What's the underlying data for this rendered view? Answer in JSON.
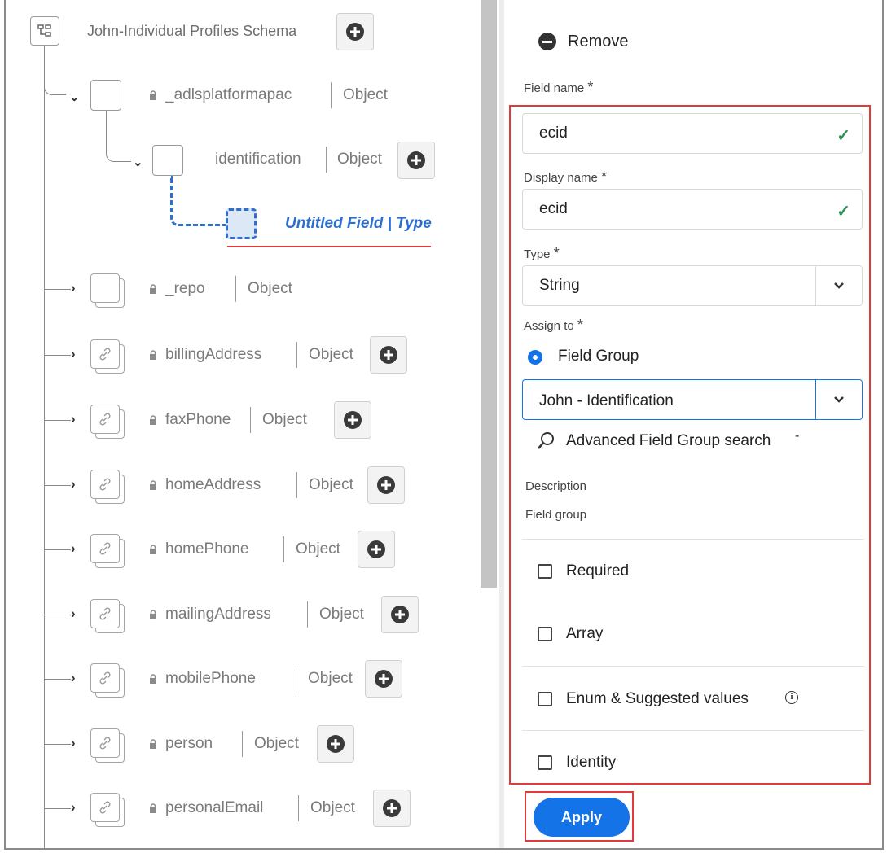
{
  "tree": {
    "root": {
      "label": "John-Individual Profiles Schema"
    },
    "nodes": [
      {
        "name": "_adlsplatformapac",
        "type": "Object"
      },
      {
        "name": "identification",
        "type": "Object"
      },
      {
        "name": "Untitled Field | Type"
      },
      {
        "name": "_repo",
        "type": "Object"
      },
      {
        "name": "billingAddress",
        "type": "Object"
      },
      {
        "name": "faxPhone",
        "type": "Object"
      },
      {
        "name": "homeAddress",
        "type": "Object"
      },
      {
        "name": "homePhone",
        "type": "Object"
      },
      {
        "name": "mailingAddress",
        "type": "Object"
      },
      {
        "name": "mobilePhone",
        "type": "Object"
      },
      {
        "name": "person",
        "type": "Object"
      },
      {
        "name": "personalEmail",
        "type": "Object"
      }
    ]
  },
  "panel": {
    "remove_label": "Remove",
    "field_name_label": "Field name",
    "field_name_value": "ecid",
    "display_name_label": "Display name",
    "display_name_value": "ecid",
    "type_label": "Type",
    "type_value": "String",
    "assign_to_label": "Assign to",
    "assign_option": "Field Group",
    "field_group_value": "John - Identification",
    "advanced_search_label": "Advanced Field Group search",
    "advanced_search_suffix": "-",
    "description_label": "Description",
    "field_group_label": "Field group",
    "checkboxes": [
      "Required",
      "Array",
      "Enum & Suggested values",
      "Identity"
    ],
    "apply_label": "Apply",
    "required_mark": "*"
  },
  "colors": {
    "accent": "#1473e6",
    "highlight": "#e03a3a",
    "check": "#2d8f55",
    "untitled": "#2c6fd1"
  }
}
